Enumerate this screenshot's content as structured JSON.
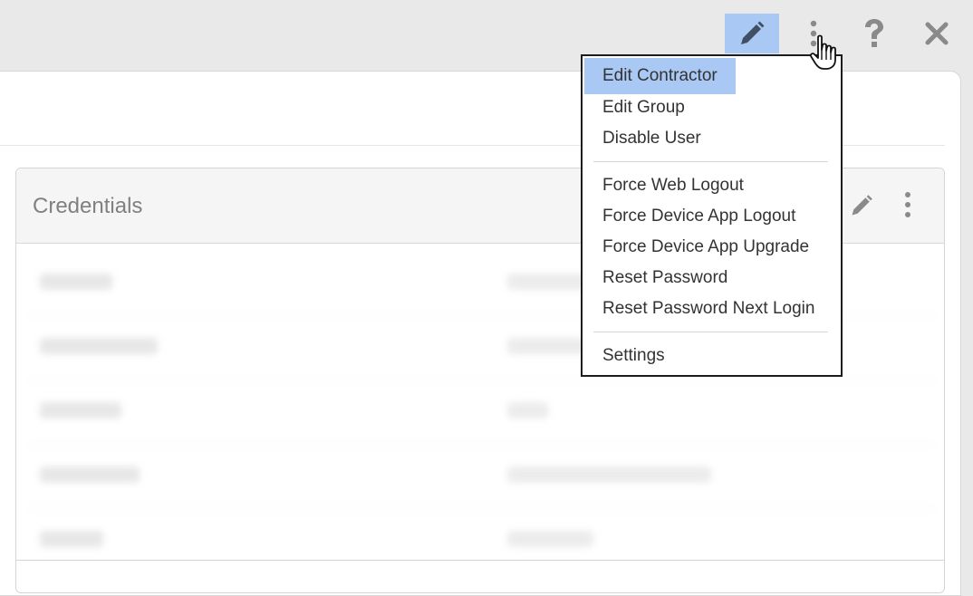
{
  "toolbar": {
    "edit_icon": "pencil-icon",
    "more_icon": "kebab-icon",
    "help_icon": "question-icon",
    "close_icon": "close-icon",
    "active_color": "#a9c8f3"
  },
  "card": {
    "title": "Credentials"
  },
  "menu": {
    "groups": [
      [
        "Edit Contractor",
        "Edit Group",
        "Disable User"
      ],
      [
        "Force Web Logout",
        "Force Device App Logout",
        "Force Device App Upgrade",
        "Reset Password",
        "Reset Password Next Login"
      ],
      [
        "Settings"
      ]
    ],
    "items": [
      "Edit Contractor",
      "Edit Group",
      "Disable User",
      "Force Web Logout",
      "Force Device App Logout",
      "Force Device App Upgrade",
      "Reset Password",
      "Reset Password Next Login",
      "Settings"
    ]
  }
}
